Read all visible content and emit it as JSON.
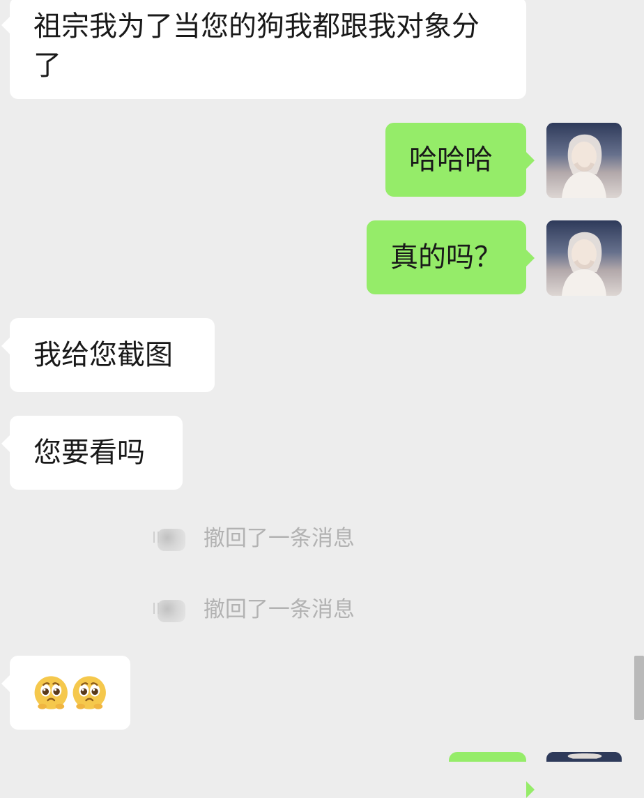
{
  "messages": [
    {
      "side": "left",
      "text": "祖宗我为了当您的狗我都跟我对象分了"
    },
    {
      "side": "right",
      "text": "哈哈哈"
    },
    {
      "side": "right",
      "text": "真的吗？"
    },
    {
      "side": "left",
      "text": "我给您截图"
    },
    {
      "side": "left",
      "text": "您要看吗"
    },
    {
      "side": "system",
      "text": "撤回了一条消息"
    },
    {
      "side": "system",
      "text": "撤回了一条消息"
    },
    {
      "side": "left",
      "text": ""
    },
    {
      "side": "right",
      "text": ""
    }
  ],
  "icons": {
    "avatar": "user-avatar-icon",
    "emoji": "pleading-face-icon"
  },
  "colors": {
    "background": "#ededed",
    "left_bubble": "#ffffff",
    "right_bubble": "#95ec69",
    "system_text": "#b2b2b2"
  }
}
